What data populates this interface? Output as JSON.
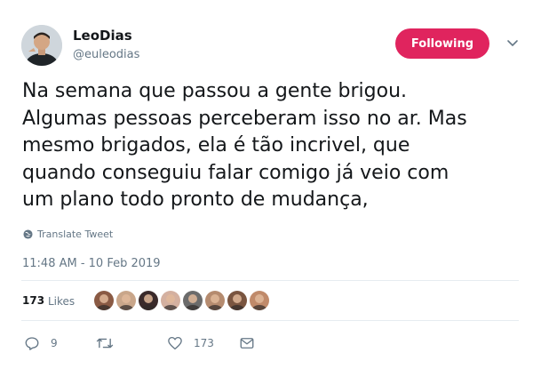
{
  "author": {
    "display_name": "LeoDias",
    "handle": "@euleodias"
  },
  "follow_button": {
    "label": "Following",
    "color": "#e0245e"
  },
  "tweet": {
    "text": "Na semana que passou a gente brigou.\nAlgumas pessoas perceberam isso no ar. Mas\nmesmo brigados, ela é tão incrivel, que\nquando conseguiu falar comigo já veio com\num plano todo pronto de mudança,",
    "translate_label": "Translate Tweet",
    "timestamp": "11:48 AM - 10 Feb 2019"
  },
  "likes": {
    "count": "173",
    "label": "Likes",
    "liker_colors": [
      "#8a5a44",
      "#c9a68a",
      "#3a2a2a",
      "#d4b0a0",
      "#6b6b6b",
      "#b58b6f",
      "#7a5540",
      "#c08a6a"
    ]
  },
  "actions": {
    "reply_count": "9",
    "retweet_count": "",
    "like_count": "173"
  },
  "colors": {
    "accent": "#e0245e",
    "secondary_text": "#657786",
    "divider": "#e6ecf0"
  }
}
